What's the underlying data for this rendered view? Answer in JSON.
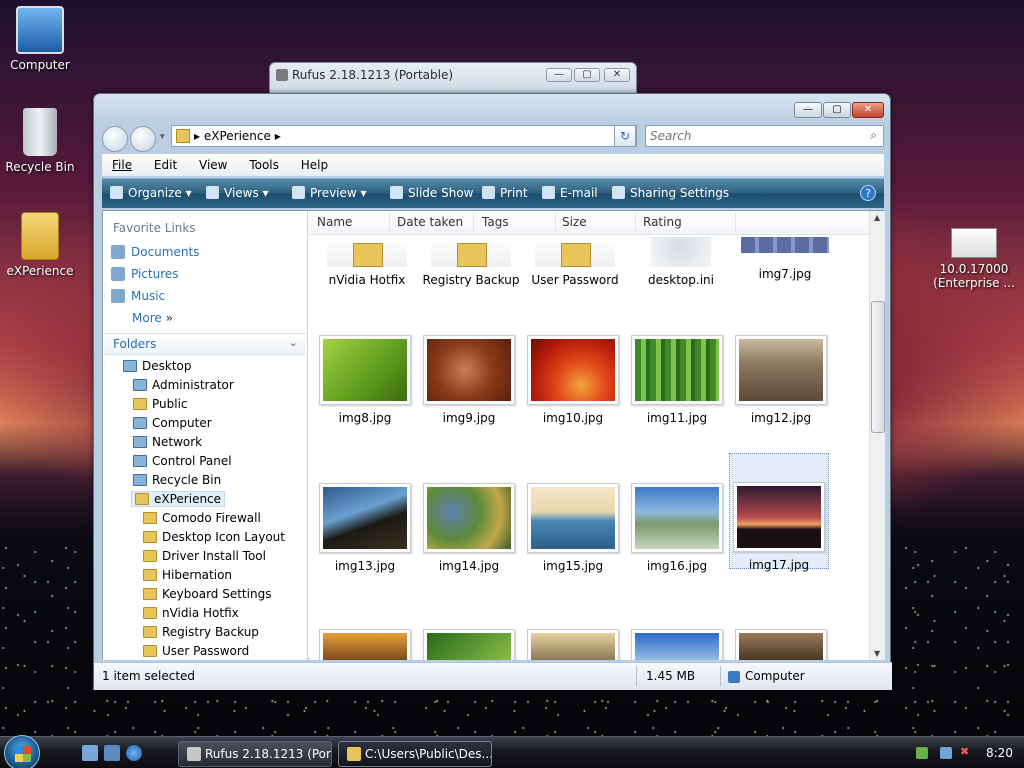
{
  "desktop": {
    "icons": [
      {
        "label": "Computer"
      },
      {
        "label": "Recycle Bin"
      },
      {
        "label": "eXPerience"
      },
      {
        "label": "10.0.17000 (Enterprise ..."
      }
    ]
  },
  "rufus": {
    "title": "Rufus 2.18.1213 (Portable)"
  },
  "explorer": {
    "address": "eXPerience",
    "search_placeholder": "Search",
    "menu": [
      "File",
      "Edit",
      "View",
      "Tools",
      "Help"
    ],
    "toolbar": [
      "Organize",
      "Views",
      "Preview",
      "Slide Show",
      "Print",
      "E-mail",
      "Sharing Settings"
    ],
    "favorites_header": "Favorite Links",
    "favorites": [
      "Documents",
      "Pictures",
      "Music",
      "More"
    ],
    "folders_header": "Folders",
    "tree": [
      "Desktop",
      "Administrator",
      "Public",
      "Computer",
      "Network",
      "Control Panel",
      "Recycle Bin",
      "eXPerience",
      "Comodo Firewall",
      "Desktop Icon Layout",
      "Driver Install Tool",
      "Hibernation",
      "Keyboard Settings",
      "nVidia Hotfix",
      "Registry Backup",
      "User Password"
    ],
    "columns": [
      "Name",
      "Date taken",
      "Tags",
      "Size",
      "Rating"
    ],
    "top_items": [
      "nVidia Hotfix",
      "Registry Backup",
      "User Password",
      "desktop.ini",
      "img7.jpg"
    ],
    "rows": [
      [
        "img8.jpg",
        "img9.jpg",
        "img10.jpg",
        "img11.jpg",
        "img12.jpg"
      ],
      [
        "img13.jpg",
        "img14.jpg",
        "img15.jpg",
        "img16.jpg",
        "img17.jpg"
      ]
    ],
    "selected": "img17.jpg",
    "status": {
      "selection": "1 item selected",
      "size": "1.45 MB",
      "location": "Computer"
    }
  },
  "taskbar": {
    "buttons": [
      "Rufus 2.18.1213 (Por...",
      "C:\\Users\\Public\\Des..."
    ],
    "clock": "8:20"
  }
}
